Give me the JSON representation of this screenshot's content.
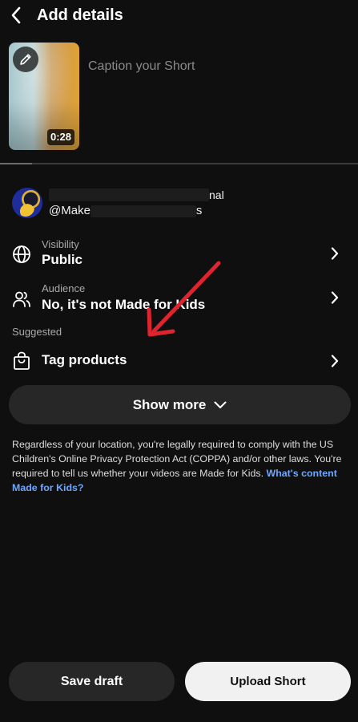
{
  "header": {
    "title": "Add details",
    "back_icon": "chevron-left-icon"
  },
  "caption": {
    "placeholder": "Caption your Short",
    "value": "",
    "thumbnail_duration": "0:28",
    "edit_icon": "pencil-icon",
    "upload_progress": 0.09
  },
  "channel": {
    "name_visible_suffix": "nal",
    "handle_visible_prefix": "@Make",
    "handle_visible_suffix": "s"
  },
  "settings": [
    {
      "id": "visibility",
      "icon": "globe-icon",
      "label": "Visibility",
      "value": "Public"
    },
    {
      "id": "audience",
      "icon": "people-icon",
      "label": "Audience",
      "value": "No, it's not Made for Kids"
    }
  ],
  "suggested": {
    "label": "Suggested",
    "items": [
      {
        "id": "tag-products",
        "icon": "shopping-bag-icon",
        "value": "Tag products"
      }
    ]
  },
  "show_more": {
    "label": "Show more",
    "icon": "chevron-down-icon"
  },
  "notice": {
    "text": "Regardless of your location, you're legally required to comply with the US Children's Online Privacy Protection Act (COPPA) and/or other laws. You're required to tell us whether your videos are Made for Kids.",
    "link": "What's content Made for Kids?"
  },
  "actions": {
    "save_draft": "Save draft",
    "upload": "Upload Short"
  },
  "colors": {
    "background": "#0f0f0f",
    "surface": "#272727",
    "link": "#6ea8fe",
    "annotation": "#e0242f"
  }
}
